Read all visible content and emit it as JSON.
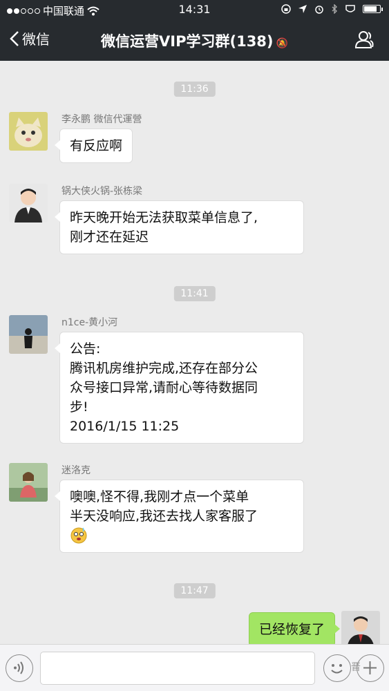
{
  "status_bar": {
    "carrier": "中国联通",
    "time": "14:31",
    "battery_level": 0.85
  },
  "nav": {
    "back_label": "微信",
    "title": "微信运营VIP学习群(138)"
  },
  "messages": [
    {
      "type": "time",
      "text": "11:36"
    },
    {
      "type": "msg",
      "sender": "李永鹏 微信代運營",
      "lines": [
        "有反应啊"
      ],
      "avatar": "cat-avatar"
    },
    {
      "type": "msg",
      "sender": "锅大侠火锅-张栋梁",
      "lines": [
        "昨天晚开始无法获取菜单信息了,",
        "刚才还在延迟"
      ],
      "avatar": "person-avatar"
    },
    {
      "type": "time",
      "text": "11:41"
    },
    {
      "type": "msg",
      "sender": "n1ce-黄小河",
      "lines": [
        "公告:",
        "腾讯机房维护完成,还存在部分公",
        "众号接口异常,请耐心等待数据同",
        "步!",
        "2016/1/15 11:25"
      ],
      "avatar": "silhouette-avatar"
    },
    {
      "type": "msg",
      "sender": "迷洛克",
      "lines": [
        "噢噢,怪不得,我刚才点一个菜单",
        "半天没响应,我还去找人家客服了"
      ],
      "avatar": "outdoor-avatar"
    },
    {
      "type": "time",
      "text": "11:47"
    },
    {
      "type": "self",
      "lines": [
        "已经恢复了"
      ],
      "avatar": "self-avatar"
    }
  ],
  "watermark": "晋"
}
